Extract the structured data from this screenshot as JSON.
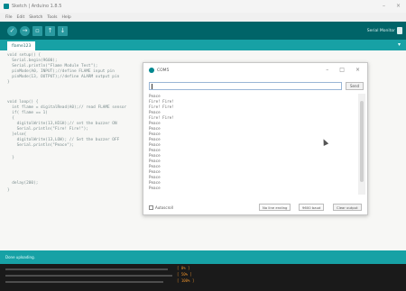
{
  "app": {
    "title": "Sketch | Arduino 1.8.5",
    "menu": [
      "File",
      "Edit",
      "Sketch",
      "Tools",
      "Help"
    ],
    "toolbar": {
      "verify_icon": "check-icon",
      "upload_icon": "arrow-right-icon",
      "new_icon": "new-file-icon",
      "open_icon": "arrow-up-icon",
      "save_icon": "arrow-down-icon",
      "serial_monitor_label": "Serial Monitor"
    },
    "tab": {
      "label": "flame123"
    },
    "colors": {
      "toolbar": "#006468",
      "tabbar": "#17a1a5",
      "console": "#1a1a1a"
    }
  },
  "code": [
    "void setup() {",
    "  Serial.begin(9600);",
    "  Serial.println(\"Flame Module Test\");",
    "  pinMode(A0, INPUT);//define FLAME input pin",
    "  pinMode(13, OUTPUT);//define ALARM output pin",
    "}",
    "",
    "void loop() {",
    "  int flame = digitalRead(A0);// read FLAME sensor",
    "  if( flame == 1)",
    "  {",
    "    digitalWrite(13,HIGH);// set the buzzer ON",
    "    Serial.println(\"Fire! Fire!\");",
    "  }else{",
    "    digitalWrite(13,LOW); // Set the buzzer OFF",
    "    Serial.println(\"Peace\");",
    "  }",
    "",
    "  delay(200);",
    "}"
  ],
  "status": {
    "message": "Done uploading."
  },
  "console": {
    "brackets": [
      "[ 0% ]",
      "[ 50% ]",
      "[ 100% ]"
    ]
  },
  "serial": {
    "title": "COM5",
    "input_value": "",
    "send_label": "Send",
    "output": [
      "Peace",
      "Fire! Fire!",
      "Fire! Fire!",
      "Peace",
      "Fire! Fire!",
      "Peace",
      "Peace",
      "Peace",
      "Peace",
      "Peace",
      "Peace",
      "Peace",
      "Peace",
      "Peace",
      "Peace",
      "Peace",
      "Peace",
      "Peace"
    ],
    "autoscroll_label": "Autoscroll",
    "line_ending": "No line ending",
    "baud_rate": "9600 baud",
    "clear_label": "Clear output"
  }
}
